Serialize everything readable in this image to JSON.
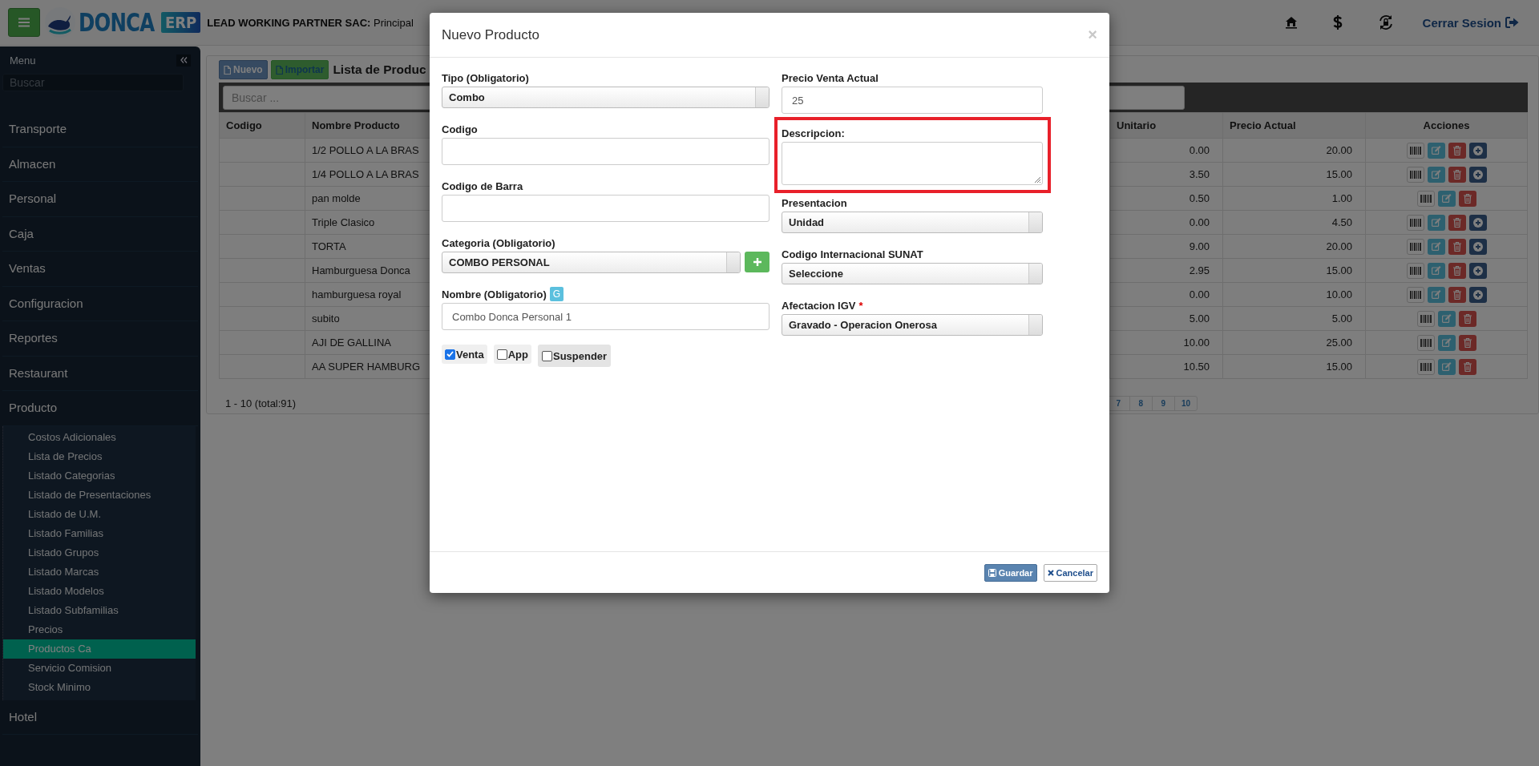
{
  "topbar": {
    "logo": {
      "name": "DONCA",
      "badge": "ERP"
    },
    "company": "**LEAD WORKING PARTNER SAC:** Principal",
    "logout": "Cerrar Sesion"
  },
  "sidebar": {
    "title": "Menu",
    "search": {
      "placeholder": "Buscar"
    },
    "items": [
      {
        "label": "Transporte"
      },
      {
        "label": "Almacen"
      },
      {
        "label": "Personal"
      },
      {
        "label": "Caja"
      },
      {
        "label": "Ventas"
      },
      {
        "label": "Configuracion"
      },
      {
        "label": "Reportes"
      },
      {
        "label": "Restaurant"
      },
      {
        "label": "Producto",
        "children": [
          {
            "label": "Costos Adicionales",
            "selected": false
          },
          {
            "label": "Lista de Precios",
            "selected": false
          },
          {
            "label": "Listado Categorias",
            "selected": false
          },
          {
            "label": "Listado de Presentaciones",
            "selected": false
          },
          {
            "label": "Listado de U.M.",
            "selected": false
          },
          {
            "label": "Listado Familias",
            "selected": false
          },
          {
            "label": "Listado Grupos",
            "selected": false
          },
          {
            "label": "Listado Marcas",
            "selected": false
          },
          {
            "label": "Listado Modelos",
            "selected": false
          },
          {
            "label": "Listado Subfamilias",
            "selected": false
          },
          {
            "label": "Precios",
            "selected": false
          },
          {
            "label": "Productos Ca",
            "selected": true
          },
          {
            "label": "Servicio Comision",
            "selected": false
          },
          {
            "label": "Stock Minimo",
            "selected": false
          }
        ]
      },
      {
        "label": "Hotel"
      }
    ]
  },
  "panel": {
    "buttons": [
      {
        "kind": "new",
        "label": "Nuevo"
      },
      {
        "kind": "import",
        "label": "Importar"
      }
    ],
    "title": "Lista de Produc",
    "search": {
      "placeholder": "Buscar ..."
    },
    "table": {
      "columns": [
        "Codigo",
        "Nombre Producto",
        "Unitario",
        "Precio Actual",
        "Acciones"
      ],
      "rows": [
        {
          "name": "1/2 POLLO A LA BRAS",
          "unit": "0.00",
          "price": "20.00",
          "actions": [
            {
              "kind": "barcode"
            },
            {
              "kind": "edit"
            },
            {
              "kind": "delete"
            },
            {
              "kind": "add"
            }
          ]
        },
        {
          "name": "1/4 POLLO A LA BRAS",
          "unit": "3.50",
          "price": "15.00",
          "actions": [
            {
              "kind": "barcode"
            },
            {
              "kind": "edit"
            },
            {
              "kind": "delete"
            },
            {
              "kind": "add"
            }
          ]
        },
        {
          "name": "pan molde",
          "unit": "0.50",
          "price": "1.00",
          "actions": [
            {
              "kind": "barcode"
            },
            {
              "kind": "edit"
            },
            {
              "kind": "delete"
            }
          ]
        },
        {
          "name": "Triple Clasico",
          "unit": "0.00",
          "price": "4.50",
          "actions": [
            {
              "kind": "barcode"
            },
            {
              "kind": "edit"
            },
            {
              "kind": "delete"
            },
            {
              "kind": "add"
            }
          ]
        },
        {
          "name": "TORTA",
          "unit": "9.00",
          "price": "20.00",
          "actions": [
            {
              "kind": "barcode"
            },
            {
              "kind": "edit"
            },
            {
              "kind": "delete"
            },
            {
              "kind": "add"
            }
          ]
        },
        {
          "name": "Hamburguesa Donca",
          "unit": "2.95",
          "price": "15.00",
          "actions": [
            {
              "kind": "barcode"
            },
            {
              "kind": "edit"
            },
            {
              "kind": "delete"
            },
            {
              "kind": "add"
            }
          ]
        },
        {
          "name": "hamburguesa royal",
          "unit": "0.00",
          "price": "10.00",
          "actions": [
            {
              "kind": "barcode"
            },
            {
              "kind": "edit"
            },
            {
              "kind": "delete"
            },
            {
              "kind": "add"
            }
          ]
        },
        {
          "name": "subito",
          "unit": "5.00",
          "price": "5.00",
          "actions": [
            {
              "kind": "barcode"
            },
            {
              "kind": "edit"
            },
            {
              "kind": "delete"
            }
          ]
        },
        {
          "name": "AJI DE GALLINA",
          "unit": "10.00",
          "price": "25.00",
          "actions": [
            {
              "kind": "barcode"
            },
            {
              "kind": "edit"
            },
            {
              "kind": "delete"
            }
          ]
        },
        {
          "name": "AA SUPER HAMBURG",
          "unit": "10.50",
          "price": "15.00",
          "actions": [
            {
              "kind": "barcode"
            },
            {
              "kind": "edit"
            },
            {
              "kind": "delete"
            }
          ]
        }
      ]
    },
    "summary": "1 - 10 (total:91)",
    "pages": [
      "7",
      "8",
      "9",
      "10"
    ]
  },
  "modal": {
    "title": "Nuevo Producto",
    "close": "×",
    "left": [
      {
        "kind": "select",
        "label": "Tipo (Obligatorio)",
        "value": "Combo"
      },
      {
        "kind": "input",
        "label": "Codigo"
      },
      {
        "kind": "input",
        "label": "Codigo de Barra"
      },
      {
        "kind": "select_add",
        "label": "Categoria (Obligatorio)",
        "value": "COMBO PERSONAL"
      },
      {
        "kind": "input",
        "label": "Nombre (Obligatorio)",
        "badge": "G",
        "value": "Combo Donca Personal 1"
      }
    ],
    "checks": [
      {
        "label": "Venta",
        "checked": true,
        "focused": false
      },
      {
        "label": "App",
        "checked": false,
        "focused": false
      },
      {
        "label": "Suspender",
        "checked": false,
        "focused": true
      }
    ],
    "right": [
      {
        "kind": "input",
        "label": "Precio Venta Actual",
        "value": "25"
      },
      {
        "kind": "textarea",
        "label": "Descripcion:",
        "highlighted": true
      },
      {
        "kind": "select",
        "label": "Presentacion",
        "value": "Unidad"
      },
      {
        "kind": "select",
        "label": "Codigo Internacional SUNAT",
        "value": "Seleccione"
      },
      {
        "kind": "select",
        "label": "Afectacion IGV",
        "required_mark": "*",
        "value": "Gravado - Operacion Onerosa"
      }
    ],
    "buttons": [
      {
        "kind": "save",
        "label": "Guardar"
      },
      {
        "kind": "cancel",
        "label": "Cancelar"
      }
    ]
  }
}
